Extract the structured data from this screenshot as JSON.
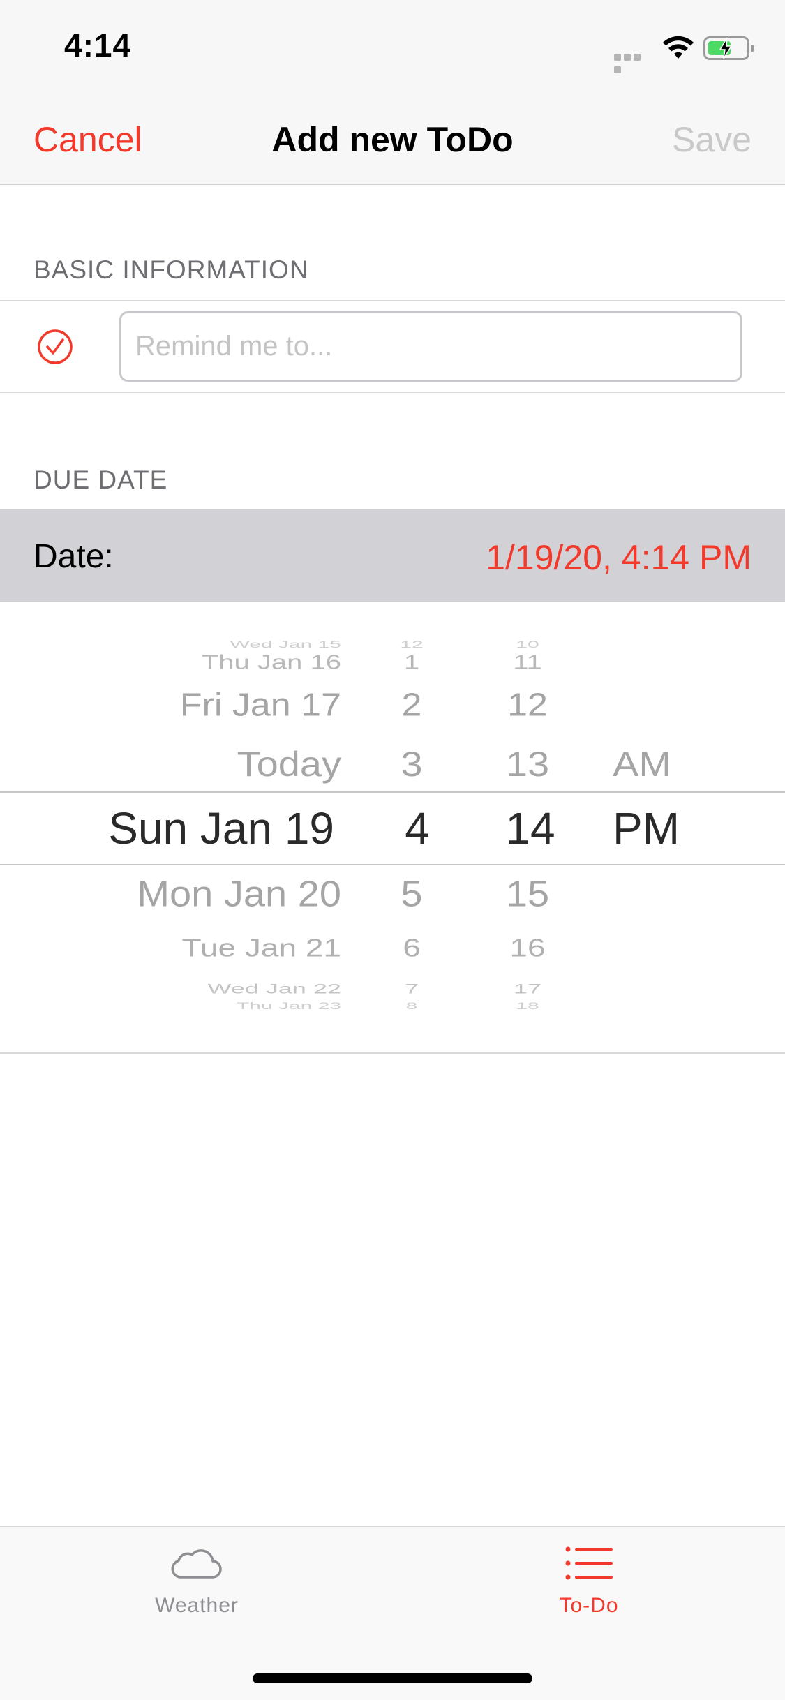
{
  "status_bar": {
    "time": "4:14"
  },
  "nav": {
    "cancel": "Cancel",
    "title": "Add new ToDo",
    "save": "Save"
  },
  "sections": {
    "basic": "BASIC INFORMATION",
    "due": "DUE DATE"
  },
  "form": {
    "reminder_placeholder": "Remind me to...",
    "date_label": "Date:",
    "date_value": "1/19/20, 4:14 PM"
  },
  "picker": {
    "dates": [
      "Wed Jan 15",
      "Thu Jan 16",
      "Fri Jan 17",
      "Today",
      "Sun Jan 19",
      "Mon Jan 20",
      "Tue Jan 21",
      "Wed Jan 22",
      "Thu Jan 23"
    ],
    "hours": [
      "12",
      "1",
      "2",
      "3",
      "4",
      "5",
      "6",
      "7",
      "8"
    ],
    "minutes": [
      "10",
      "11",
      "12",
      "13",
      "14",
      "15",
      "16",
      "17",
      "18"
    ],
    "ampm": [
      "AM",
      "PM"
    ],
    "selected": {
      "date": "Sun Jan 19",
      "hour": "4",
      "minute": "14",
      "period": "PM"
    }
  },
  "tabs": [
    {
      "label": "Weather",
      "icon": "cloud-icon",
      "active": false
    },
    {
      "label": "To-Do",
      "icon": "list-icon",
      "active": true
    }
  ],
  "colors": {
    "accent": "#f3392c",
    "disabled": "#c9c9c9",
    "section_header": "#6d6d72",
    "date_row_bg": "#d1d1d6"
  }
}
